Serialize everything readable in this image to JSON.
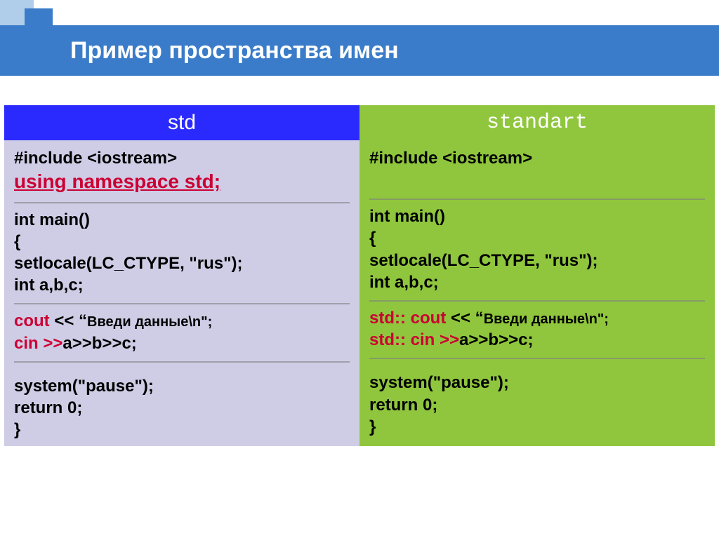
{
  "title": "Пример пространства имен",
  "headers": {
    "left": "std",
    "right": "standart"
  },
  "left": {
    "sec1_l1": "#include <iostream>",
    "sec1_l2": "using namespace std;",
    "sec2_l1": "int main()",
    "sec2_l2": "{",
    "sec2_l3": "setlocale(LC_CTYPE, \"rus\");",
    "sec2_l4": "int a,b,c;",
    "sec3_l1a": "cout",
    "sec3_l1b": " << “",
    "sec3_l1c": "Введи данные\\n\";",
    "sec3_l2a": "cin",
    "sec3_l2b": " >>",
    "sec3_l2c": "a>>b>>c;",
    "sec4_l1": "system(\"pause\");",
    "sec4_l2": "return 0;",
    "sec4_l3": "}"
  },
  "right": {
    "sec1_l1": "#include <iostream>",
    "sec2_l1": "int main()",
    "sec2_l2": "{",
    "sec2_l3": "setlocale(LC_CTYPE, \"rus\");",
    "sec2_l4": "int a,b,c;",
    "sec3_l1a": "std:: cout",
    "sec3_l1b": " << “",
    "sec3_l1c": "Введи данные\\n\";",
    "sec3_l2a": "std:: cin",
    "sec3_l2b": " >>",
    "sec3_l2c": "a>>b>>c;",
    "sec4_l1": "system(\"pause\");",
    "sec4_l2": "return 0;",
    "sec4_l3": "}"
  }
}
